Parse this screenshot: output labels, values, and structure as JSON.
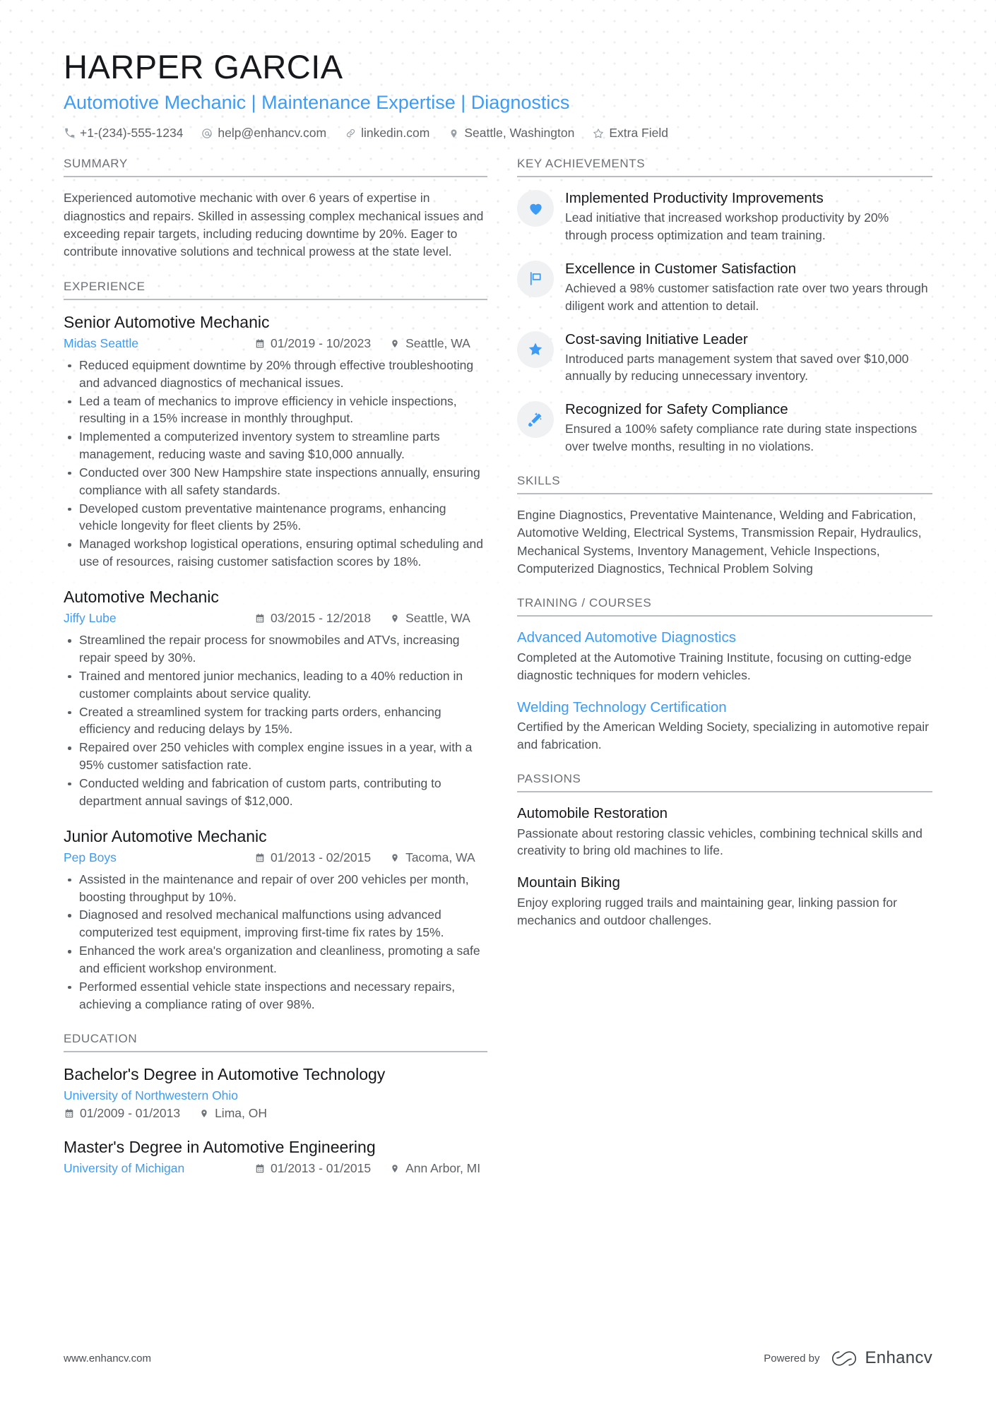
{
  "header": {
    "name": "HARPER GARCIA",
    "headline": "Automotive Mechanic | Maintenance Expertise | Diagnostics",
    "contacts": [
      {
        "icon": "phone-icon",
        "text": "+1-(234)-555-1234"
      },
      {
        "icon": "email-icon",
        "text": "help@enhancv.com"
      },
      {
        "icon": "link-icon",
        "text": "linkedin.com"
      },
      {
        "icon": "location-pin-icon",
        "text": "Seattle, Washington"
      },
      {
        "icon": "star-outline-icon",
        "text": "Extra Field"
      }
    ]
  },
  "summary": {
    "heading": "SUMMARY",
    "text": "Experienced automotive mechanic with over 6 years of expertise in diagnostics and repairs. Skilled in assessing complex mechanical issues and exceeding repair targets, including reducing downtime by 20%. Eager to contribute innovative solutions and technical prowess at the state level."
  },
  "experience": {
    "heading": "EXPERIENCE",
    "entries": [
      {
        "title": "Senior Automotive Mechanic",
        "company": "Midas Seattle",
        "dates": "01/2019 - 10/2023",
        "location": "Seattle, WA",
        "bullets": [
          "Reduced equipment downtime by 20% through effective troubleshooting and advanced diagnostics of mechanical issues.",
          "Led a team of mechanics to improve efficiency in vehicle inspections, resulting in a 15% increase in monthly throughput.",
          "Implemented a computerized inventory system to streamline parts management, reducing waste and saving $10,000 annually.",
          "Conducted over 300 New Hampshire state inspections annually, ensuring compliance with all safety standards.",
          "Developed custom preventative maintenance programs, enhancing vehicle longevity for fleet clients by 25%.",
          "Managed workshop logistical operations, ensuring optimal scheduling and use of resources, raising customer satisfaction scores by 18%."
        ]
      },
      {
        "title": "Automotive Mechanic",
        "company": "Jiffy Lube",
        "dates": "03/2015 - 12/2018",
        "location": "Seattle, WA",
        "bullets": [
          "Streamlined the repair process for snowmobiles and ATVs, increasing repair speed by 30%.",
          "Trained and mentored junior mechanics, leading to a 40% reduction in customer complaints about service quality.",
          "Created a streamlined system for tracking parts orders, enhancing efficiency and reducing delays by 15%.",
          "Repaired over 250 vehicles with complex engine issues in a year, with a 95% customer satisfaction rate.",
          "Conducted welding and fabrication of custom parts, contributing to department annual savings of $12,000."
        ]
      },
      {
        "title": "Junior Automotive Mechanic",
        "company": "Pep Boys",
        "dates": "01/2013 - 02/2015",
        "location": "Tacoma, WA",
        "bullets": [
          "Assisted in the maintenance and repair of over 200 vehicles per month, boosting throughput by 10%.",
          "Diagnosed and resolved mechanical malfunctions using advanced computerized test equipment, improving first-time fix rates by 15%.",
          "Enhanced the work area's organization and cleanliness, promoting a safe and efficient workshop environment.",
          "Performed essential vehicle state inspections and necessary repairs, achieving a compliance rating of over 98%."
        ]
      }
    ]
  },
  "education": {
    "heading": "EDUCATION",
    "entries": [
      {
        "degree": "Bachelor's Degree in Automotive Technology",
        "school": "University of Northwestern Ohio",
        "dates": "01/2009 - 01/2013",
        "location": "Lima, OH",
        "stacked": true
      },
      {
        "degree": "Master's Degree in Automotive Engineering",
        "school": "University of Michigan",
        "dates": "01/2013 - 01/2015",
        "location": "Ann Arbor, MI",
        "stacked": false
      }
    ]
  },
  "key_achievements": {
    "heading": "KEY ACHIEVEMENTS",
    "items": [
      {
        "icon": "heart-icon",
        "title": "Implemented Productivity Improvements",
        "desc": "Lead initiative that increased workshop productivity by 20% through process optimization and team training."
      },
      {
        "icon": "flag-icon",
        "title": "Excellence in Customer Satisfaction",
        "desc": "Achieved a 98% customer satisfaction rate over two years through diligent work and attention to detail."
      },
      {
        "icon": "star-icon",
        "title": "Cost-saving Initiative Leader",
        "desc": "Introduced parts management system that saved over $10,000 annually by reducing unnecessary inventory."
      },
      {
        "icon": "magic-wand-icon",
        "title": "Recognized for Safety Compliance",
        "desc": "Ensured a 100% safety compliance rate during state inspections over twelve months, resulting in no violations."
      }
    ]
  },
  "skills": {
    "heading": "SKILLS",
    "text": "Engine Diagnostics, Preventative Maintenance, Welding and Fabrication, Automotive Welding, Electrical Systems, Transmission Repair, Hydraulics, Mechanical Systems, Inventory Management, Vehicle Inspections, Computerized Diagnostics, Technical Problem Solving"
  },
  "training": {
    "heading": "TRAINING / COURSES",
    "entries": [
      {
        "title": "Advanced Automotive Diagnostics",
        "desc": "Completed at the Automotive Training Institute, focusing on cutting-edge diagnostic techniques for modern vehicles."
      },
      {
        "title": "Welding Technology Certification",
        "desc": "Certified by the American Welding Society, specializing in automotive repair and fabrication."
      }
    ]
  },
  "passions": {
    "heading": "PASSIONS",
    "entries": [
      {
        "title": "Automobile Restoration",
        "desc": "Passionate about restoring classic vehicles, combining technical skills and creativity to bring old machines to life."
      },
      {
        "title": "Mountain Biking",
        "desc": "Enjoy exploring rugged trails and maintaining gear, linking passion for mechanics and outdoor challenges."
      }
    ]
  },
  "footer": {
    "url": "www.enhancv.com",
    "powered_by": "Powered by",
    "brand": "Enhancv"
  },
  "colors": {
    "accent": "#3d9bf5",
    "heading_text": "#6c7076",
    "body_text": "#4c5057",
    "title_text": "#16181c",
    "rule": "#b9bcc1",
    "badge_bg": "#f0f1f3"
  }
}
